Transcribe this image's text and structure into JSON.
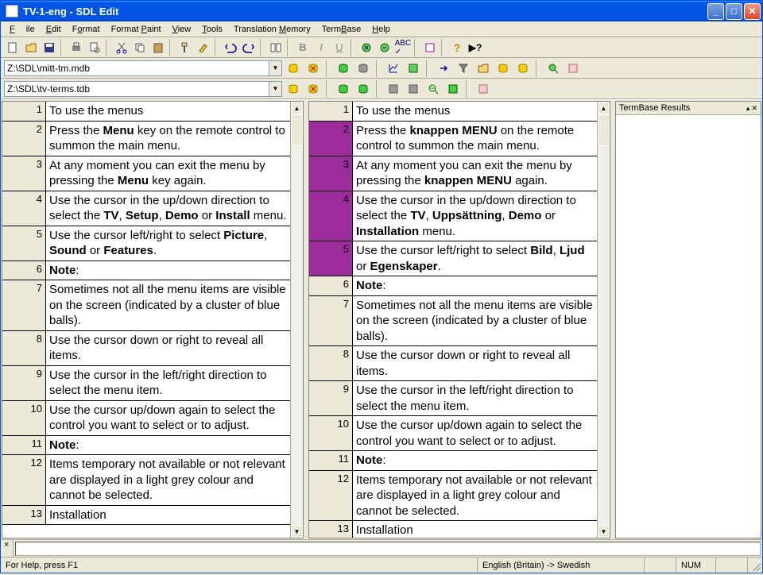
{
  "window": {
    "title": "TV-1-eng - SDL Edit"
  },
  "menu": {
    "file": "File",
    "edit": "Edit",
    "format": "Format",
    "formatpaint": "Format Paint",
    "view": "View",
    "tools": "Tools",
    "tm": "Translation Memory",
    "termbase": "TermBase",
    "help": "Help"
  },
  "combos": {
    "tm_path": "Z:\\SDL\\mitt-tm.mdb",
    "tb_path": "Z:\\SDL\\tv-terms.tdb"
  },
  "term_panel": {
    "title": "TermBase Results"
  },
  "status": {
    "help": "For Help, press F1",
    "lang": "English (Britain) -> Swedish",
    "num": "NUM"
  },
  "source": [
    {
      "n": "1",
      "html": "To use the menus"
    },
    {
      "n": "2",
      "html": "Press the <b>Menu</b> key on the remote control to summon the main menu."
    },
    {
      "n": "3",
      "html": "At any moment you can exit the menu by pressing the <b>Menu</b> key again."
    },
    {
      "n": "4",
      "html": "Use the cursor in the up/down direction to select the <b>TV</b>, <b>Setup</b>, <b>Demo</b> or <b>Install</b> menu."
    },
    {
      "n": "5",
      "html": "Use the cursor left/right to select <b>Picture</b>, <b>Sound</b> or <b>Features</b>."
    },
    {
      "n": "6",
      "html": "<b>Note</b>:"
    },
    {
      "n": "7",
      "html": "Sometimes not all the menu items are visible on the screen (indicated by a cluster of blue balls)."
    },
    {
      "n": "8",
      "html": "Use the cursor down or right to reveal all items."
    },
    {
      "n": "9",
      "html": "Use the cursor in the left/right direction to select the menu item."
    },
    {
      "n": "10",
      "html": "Use the cursor up/down again to select the control you want to select or to adjust."
    },
    {
      "n": "11",
      "html": "<b>Note</b>:"
    },
    {
      "n": "12",
      "html": "Items temporary not available or not relevant are displayed in a light grey colour and cannot be selected."
    },
    {
      "n": "13",
      "html": "Installation"
    }
  ],
  "target": [
    {
      "n": "1",
      "html": "To use the menus",
      "hl": false
    },
    {
      "n": "2",
      "html": "Press the <b>knappen MENU</b> on the remote control to summon the main menu.",
      "hl": true
    },
    {
      "n": "3",
      "html": "At any moment you can exit the menu by pressing the <b>knappen MENU</b> again.",
      "hl": true
    },
    {
      "n": "4",
      "html": "Use the cursor in the up/down direction to select the <b>TV</b>, <b>Uppsättning</b>, <b>Demo</b> or <b>Installation</b> menu.",
      "hl": true
    },
    {
      "n": "5",
      "html": "Use the cursor left/right to select <b>Bild</b>, <b>Ljud</b> or <b>Egenskaper</b>.",
      "hl": true
    },
    {
      "n": "6",
      "html": "<b>Note</b>:",
      "hl": false
    },
    {
      "n": "7",
      "html": "Sometimes not all the menu items are visible on the screen (indicated by a cluster of blue balls).",
      "hl": false
    },
    {
      "n": "8",
      "html": "Use the cursor down or right to reveal all items.",
      "hl": false
    },
    {
      "n": "9",
      "html": "Use the cursor in the left/right direction to select the menu item.",
      "hl": false
    },
    {
      "n": "10",
      "html": "Use the cursor up/down again to select the control you want to select or to adjust.",
      "hl": false
    },
    {
      "n": "11",
      "html": "<b>Note</b>:",
      "hl": false
    },
    {
      "n": "12",
      "html": "Items temporary not available or not relevant are displayed in a light grey colour and cannot be selected.",
      "hl": false
    },
    {
      "n": "13",
      "html": "Installation",
      "hl": false
    }
  ],
  "icons": {
    "new": "new-icon",
    "open": "open-icon",
    "save": "save-icon",
    "print": "print-icon",
    "preview": "preview-icon",
    "cut": "cut-icon",
    "copy": "copy-icon",
    "paste": "paste-icon",
    "paintroller": "paint-icon",
    "brush": "brush-icon",
    "undo": "undo-icon",
    "redo": "redo-icon",
    "bold": "B",
    "italic": "I",
    "underline": "U",
    "tm1": "tm-open",
    "tm2": "tm-close",
    "tb1": "tb-icon",
    "help": "?",
    "whatsthis": "?>"
  }
}
